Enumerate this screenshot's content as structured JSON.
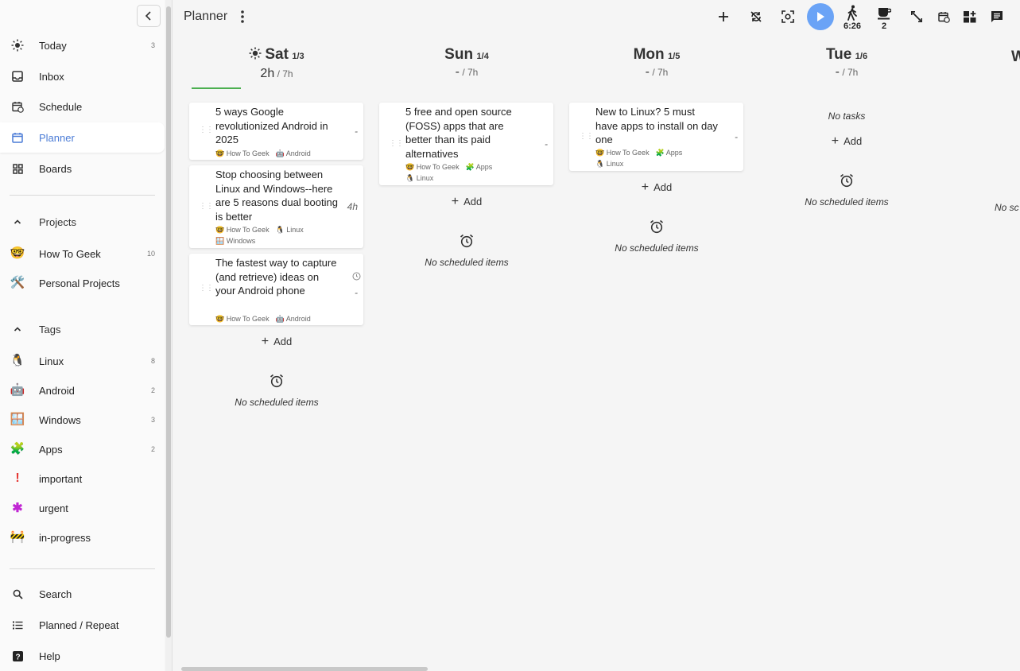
{
  "header": {
    "title": "Planner",
    "timer_value": "6:26",
    "break_count": "2"
  },
  "sidebar": {
    "nav": [
      {
        "label": "Today",
        "count": "3"
      },
      {
        "label": "Inbox",
        "count": ""
      },
      {
        "label": "Schedule",
        "count": ""
      },
      {
        "label": "Planner",
        "count": ""
      },
      {
        "label": "Boards",
        "count": ""
      }
    ],
    "projects_heading": "Projects",
    "projects": [
      {
        "emoji": "🤓",
        "label": "How To Geek",
        "count": "10"
      },
      {
        "emoji": "🛠️",
        "label": "Personal Projects",
        "count": ""
      }
    ],
    "tags_heading": "Tags",
    "tags": [
      {
        "emoji": "🐧",
        "label": "Linux",
        "count": "8"
      },
      {
        "emoji": "🤖",
        "label": "Android",
        "count": "2"
      },
      {
        "emoji": "🪟",
        "label": "Windows",
        "count": "3"
      },
      {
        "emoji": "🧩",
        "label": "Apps",
        "count": "2"
      },
      {
        "emoji": "!",
        "label": "important",
        "count": ""
      },
      {
        "emoji": "✱",
        "label": "urgent",
        "count": ""
      },
      {
        "emoji": "🚧",
        "label": "in-progress",
        "count": ""
      }
    ],
    "bottom": [
      {
        "label": "Search"
      },
      {
        "label": "Planned / Repeat"
      },
      {
        "label": "Help"
      }
    ]
  },
  "days": [
    {
      "name": "Sat",
      "date": "1/3",
      "time_done": "2h",
      "time_total": "/ 7h",
      "tasks": [
        {
          "title": "5 ways Google revolutionized Android in 2025",
          "est": "-",
          "tags": [
            "🤓 How To Geek",
            "🤖 Android"
          ]
        },
        {
          "title": "Stop choosing between Linux and Windows--here are 5 reasons dual booting is better",
          "est": "4h",
          "tags": [
            "🤓 How To Geek",
            "🐧 Linux",
            "🪟 Windows"
          ]
        },
        {
          "title": "The fastest way to capture (and retrieve) ideas on your Android phone",
          "est": "-",
          "tags": [
            "🤓 How To Geek",
            "🤖 Android"
          ]
        }
      ],
      "add_label": "Add",
      "no_scheduled": "No scheduled items"
    },
    {
      "name": "Sun",
      "date": "1/4",
      "time_done": "-",
      "time_total": "/ 7h",
      "tasks": [
        {
          "title": "5 free and open source (FOSS) apps that are better than its paid alternatives",
          "est": "-",
          "tags": [
            "🤓 How To Geek",
            "🧩 Apps",
            "🐧 Linux"
          ]
        }
      ],
      "add_label": "Add",
      "no_scheduled": "No scheduled items"
    },
    {
      "name": "Mon",
      "date": "1/5",
      "time_done": "-",
      "time_total": "/ 7h",
      "tasks": [
        {
          "title": "New to Linux? 5 must have apps to install on day one",
          "est": "-",
          "tags": [
            "🤓 How To Geek",
            "🧩 Apps",
            "🐧 Linux"
          ]
        }
      ],
      "add_label": "Add",
      "no_scheduled": "No scheduled items"
    },
    {
      "name": "Tue",
      "date": "1/6",
      "time_done": "-",
      "time_total": "/ 7h",
      "no_tasks": "No tasks",
      "add_label": "Add",
      "no_scheduled": "No scheduled items"
    },
    {
      "name": "W",
      "no_scheduled": "No sc"
    }
  ]
}
